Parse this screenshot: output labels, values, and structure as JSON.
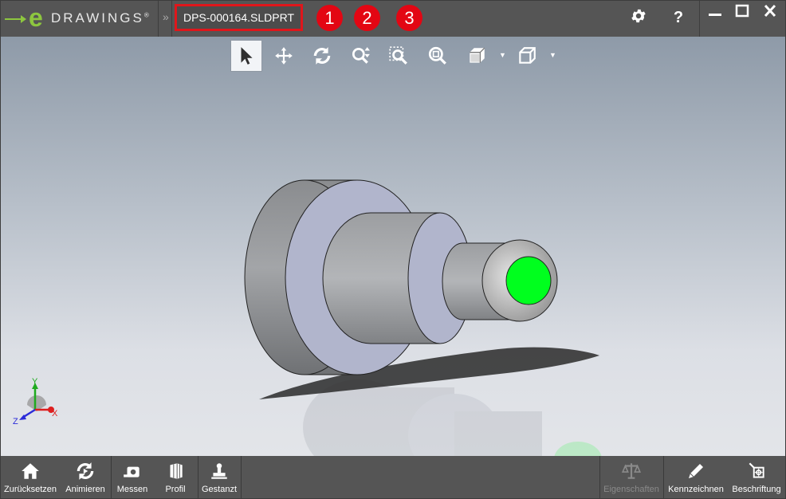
{
  "app": {
    "logo_letter": "e",
    "logo_word": "DRAWINGS",
    "logo_mark": "®",
    "breadcrumb_sep": "»",
    "file_name": "DPS-000164.SLDPRT",
    "badges": [
      "1",
      "2",
      "3"
    ],
    "settings_icon": "gear-icon",
    "help_label": "?"
  },
  "window_controls": {
    "minimize": "minimize-icon",
    "maximize": "maximize-icon",
    "close": "close-icon"
  },
  "view_toolbar": {
    "tools": [
      {
        "name": "select",
        "icon": "cursor-arrow-icon",
        "active": true
      },
      {
        "name": "pan",
        "icon": "pan-move-icon"
      },
      {
        "name": "rotate",
        "icon": "rotate-icon"
      },
      {
        "name": "zoom",
        "icon": "zoom-updown-icon"
      },
      {
        "name": "zoom-to-area",
        "icon": "zoom-area-icon"
      },
      {
        "name": "zoom-to-fit",
        "icon": "zoom-fit-icon"
      },
      {
        "name": "views",
        "icon": "view-cube-icon"
      },
      {
        "name": "display-style",
        "icon": "display-box-icon"
      }
    ]
  },
  "triad": {
    "x": "X",
    "y": "Y",
    "z": "Z"
  },
  "colors": {
    "bar": "#555555",
    "highlight_red": "#e0161b",
    "face_green": "#00ff1e",
    "accent_green": "#8dc63f"
  },
  "bottom_toolbar": {
    "left": [
      {
        "label": "Zurücksetzen",
        "icon": "home-icon"
      },
      {
        "label": "Animieren",
        "icon": "animate-icon"
      },
      {
        "label": "Messen",
        "icon": "measure-icon"
      },
      {
        "label": "Profil",
        "icon": "section-icon"
      },
      {
        "label": "Gestanzt",
        "icon": "stamp-icon"
      }
    ],
    "right": [
      {
        "label": "Eigenschaften",
        "icon": "scale-icon",
        "disabled": true
      },
      {
        "label": "Kennzeichnen",
        "icon": "pencil-icon"
      },
      {
        "label": "Beschriftung",
        "icon": "annotation-icon"
      }
    ]
  }
}
